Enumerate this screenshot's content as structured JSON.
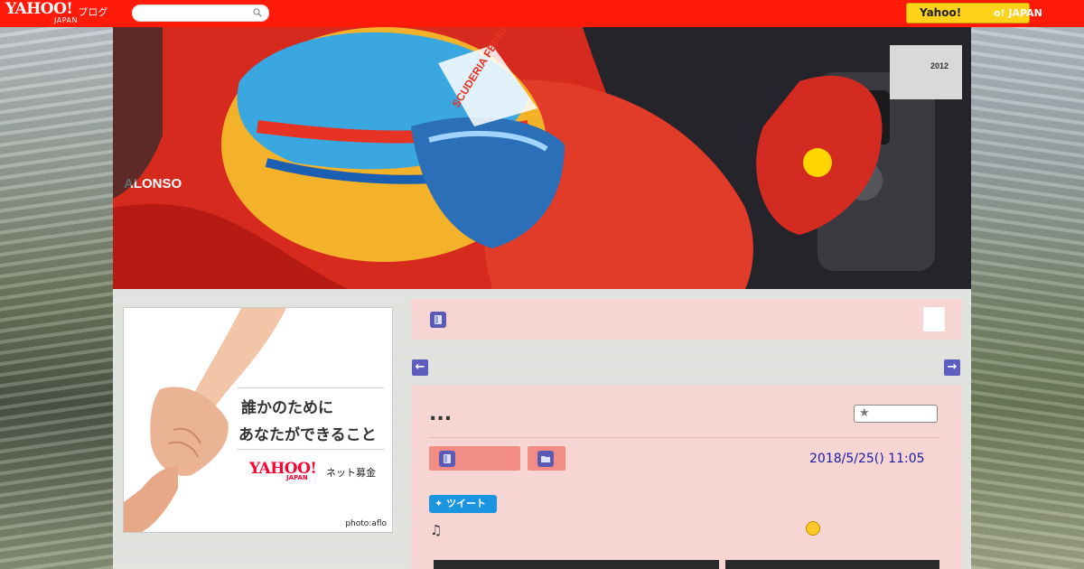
{
  "header": {
    "logo_yahoo": "YAHOO!",
    "logo_japan": "JAPAN",
    "logo_blog": "ブログ",
    "search_placeholder": "",
    "search_icon": "search-icon",
    "yahoo_button_label": "Yahoo!",
    "yahoo_japan_link": "o! JAPAN",
    "colors": {
      "bar": "#ff1a0a",
      "button": "#ffd21a"
    }
  },
  "hero": {
    "driver_label": "ALONSO",
    "helmet_text": "SCUDERIA FERRARI",
    "plaque_year": "2012"
  },
  "ad": {
    "line1": "誰かのために",
    "line2": "あなたができること",
    "brand": "YAHOO!",
    "brand_sub": "JAPAN",
    "service": "ネット募金",
    "credit": "photo:aflo"
  },
  "post_bar": {
    "icon": "document-icon"
  },
  "nav": {
    "prev_icon": "arrow-left-icon",
    "next_icon": "arrow-right-icon"
  },
  "article": {
    "title": "...",
    "favorite_icon": "star-icon",
    "category_icon": "document-icon",
    "folder_icon": "folder-icon",
    "date": "2018/5/25()  11:05",
    "tweet_label": "ツイート",
    "body_note": "♫",
    "emoji_icon": "smile-icon",
    "colors": {
      "panel": "#f6d5d3",
      "category_button": "#f28d86",
      "date": "#1a1aa6"
    }
  }
}
